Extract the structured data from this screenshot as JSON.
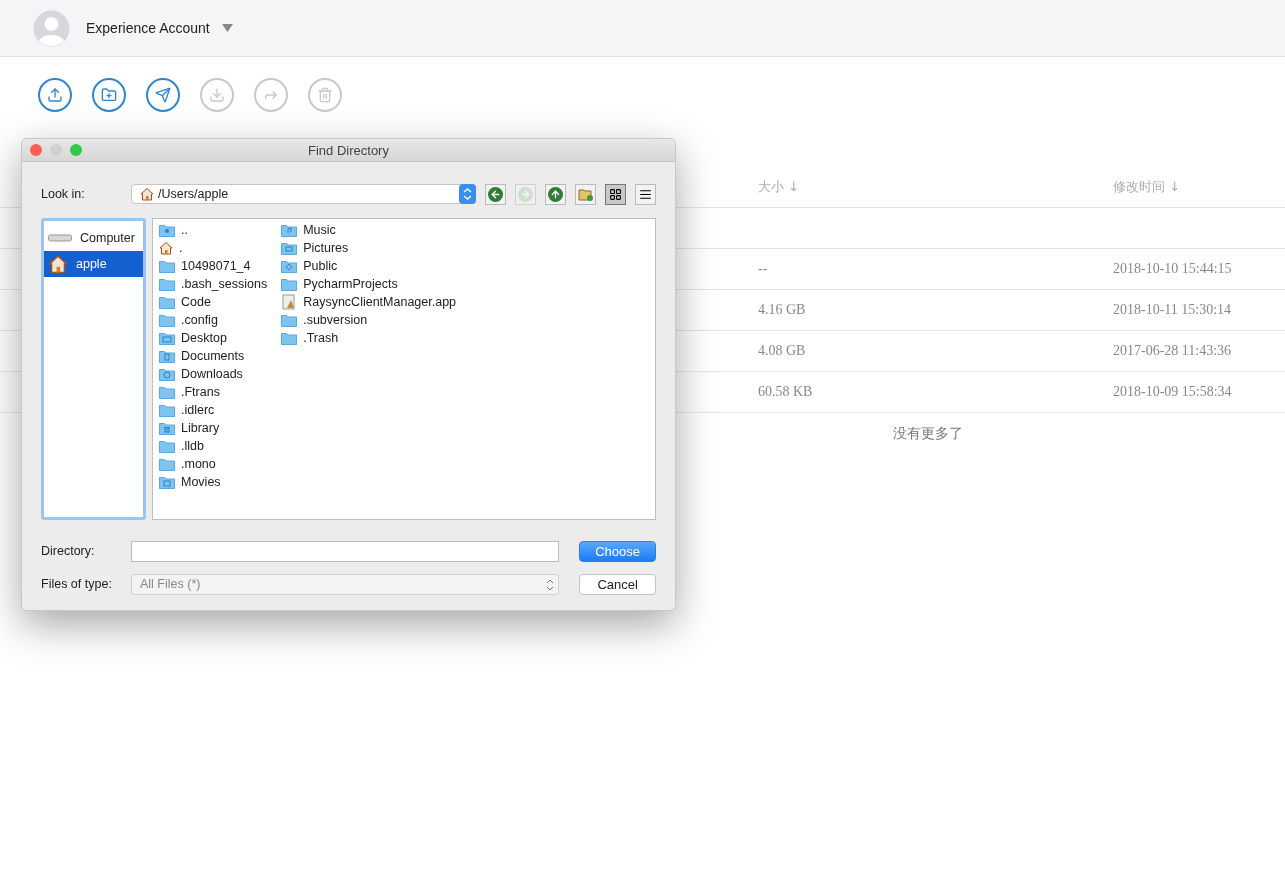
{
  "account": {
    "name": "Experience Account"
  },
  "toolbar": [
    {
      "kind": "upload",
      "disabled": false
    },
    {
      "kind": "new-folder",
      "disabled": false
    },
    {
      "kind": "send",
      "disabled": false
    },
    {
      "kind": "download",
      "disabled": true
    },
    {
      "kind": "share",
      "disabled": true
    },
    {
      "kind": "delete",
      "disabled": true
    }
  ],
  "table": {
    "columns": [
      "大小 ↓",
      "修改时间 ↓"
    ],
    "rows": [
      {
        "size": "--",
        "modified": "2018-10-10 15:44:15"
      },
      {
        "size": "4.16 GB",
        "modified": "2018-10-11 15:30:14"
      },
      {
        "size": "4.08 GB",
        "modified": "2017-06-28 11:43:36"
      },
      {
        "size": "60.58 KB",
        "modified": "2018-10-09 15:58:34"
      }
    ],
    "footer": "没有更多了"
  },
  "dialog": {
    "title": "Find Directory",
    "look_in_label": "Look in:",
    "look_in_path": "/Users/apple",
    "nav_buttons": [
      {
        "kind": "back",
        "disabled": false,
        "selected": false
      },
      {
        "kind": "forward",
        "disabled": true,
        "selected": false
      },
      {
        "kind": "up",
        "disabled": false,
        "selected": false
      },
      {
        "kind": "new-folder",
        "disabled": false,
        "selected": false
      },
      {
        "kind": "icon-view",
        "disabled": false,
        "selected": true
      },
      {
        "kind": "list-view",
        "disabled": false,
        "selected": false
      }
    ],
    "places": [
      {
        "label": "Computer",
        "kind": "computer",
        "selected": false
      },
      {
        "label": "apple",
        "kind": "home",
        "selected": true
      }
    ],
    "files": [
      {
        "name": "..",
        "kind": "user"
      },
      {
        "name": ".",
        "kind": "home"
      },
      {
        "name": "10498071_4",
        "kind": "folder"
      },
      {
        "name": ".bash_sessions",
        "kind": "folder"
      },
      {
        "name": "Code",
        "kind": "folder"
      },
      {
        "name": ".config",
        "kind": "folder"
      },
      {
        "name": "Desktop",
        "kind": "desktop"
      },
      {
        "name": "Documents",
        "kind": "documents"
      },
      {
        "name": "Downloads",
        "kind": "downloads"
      },
      {
        "name": ".Ftrans",
        "kind": "folder"
      },
      {
        "name": ".idlerc",
        "kind": "folder"
      },
      {
        "name": "Library",
        "kind": "library"
      },
      {
        "name": ".lldb",
        "kind": "folder"
      },
      {
        "name": ".mono",
        "kind": "folder"
      },
      {
        "name": "Movies",
        "kind": "movies"
      },
      {
        "name": "Music",
        "kind": "music"
      },
      {
        "name": "Pictures",
        "kind": "pictures"
      },
      {
        "name": "Public",
        "kind": "public"
      },
      {
        "name": "PycharmProjects",
        "kind": "folder"
      },
      {
        "name": "RaysyncClientManager.app",
        "kind": "app"
      },
      {
        "name": ".subversion",
        "kind": "folder"
      },
      {
        "name": ".Trash",
        "kind": "folder"
      }
    ],
    "directory_label": "Directory:",
    "files_of_type_label": "Files of type:",
    "files_of_type_value": "All Files (*)",
    "buttons": [
      {
        "label": "Choose",
        "kind": "primary"
      },
      {
        "label": "Cancel",
        "kind": "normal"
      }
    ]
  }
}
